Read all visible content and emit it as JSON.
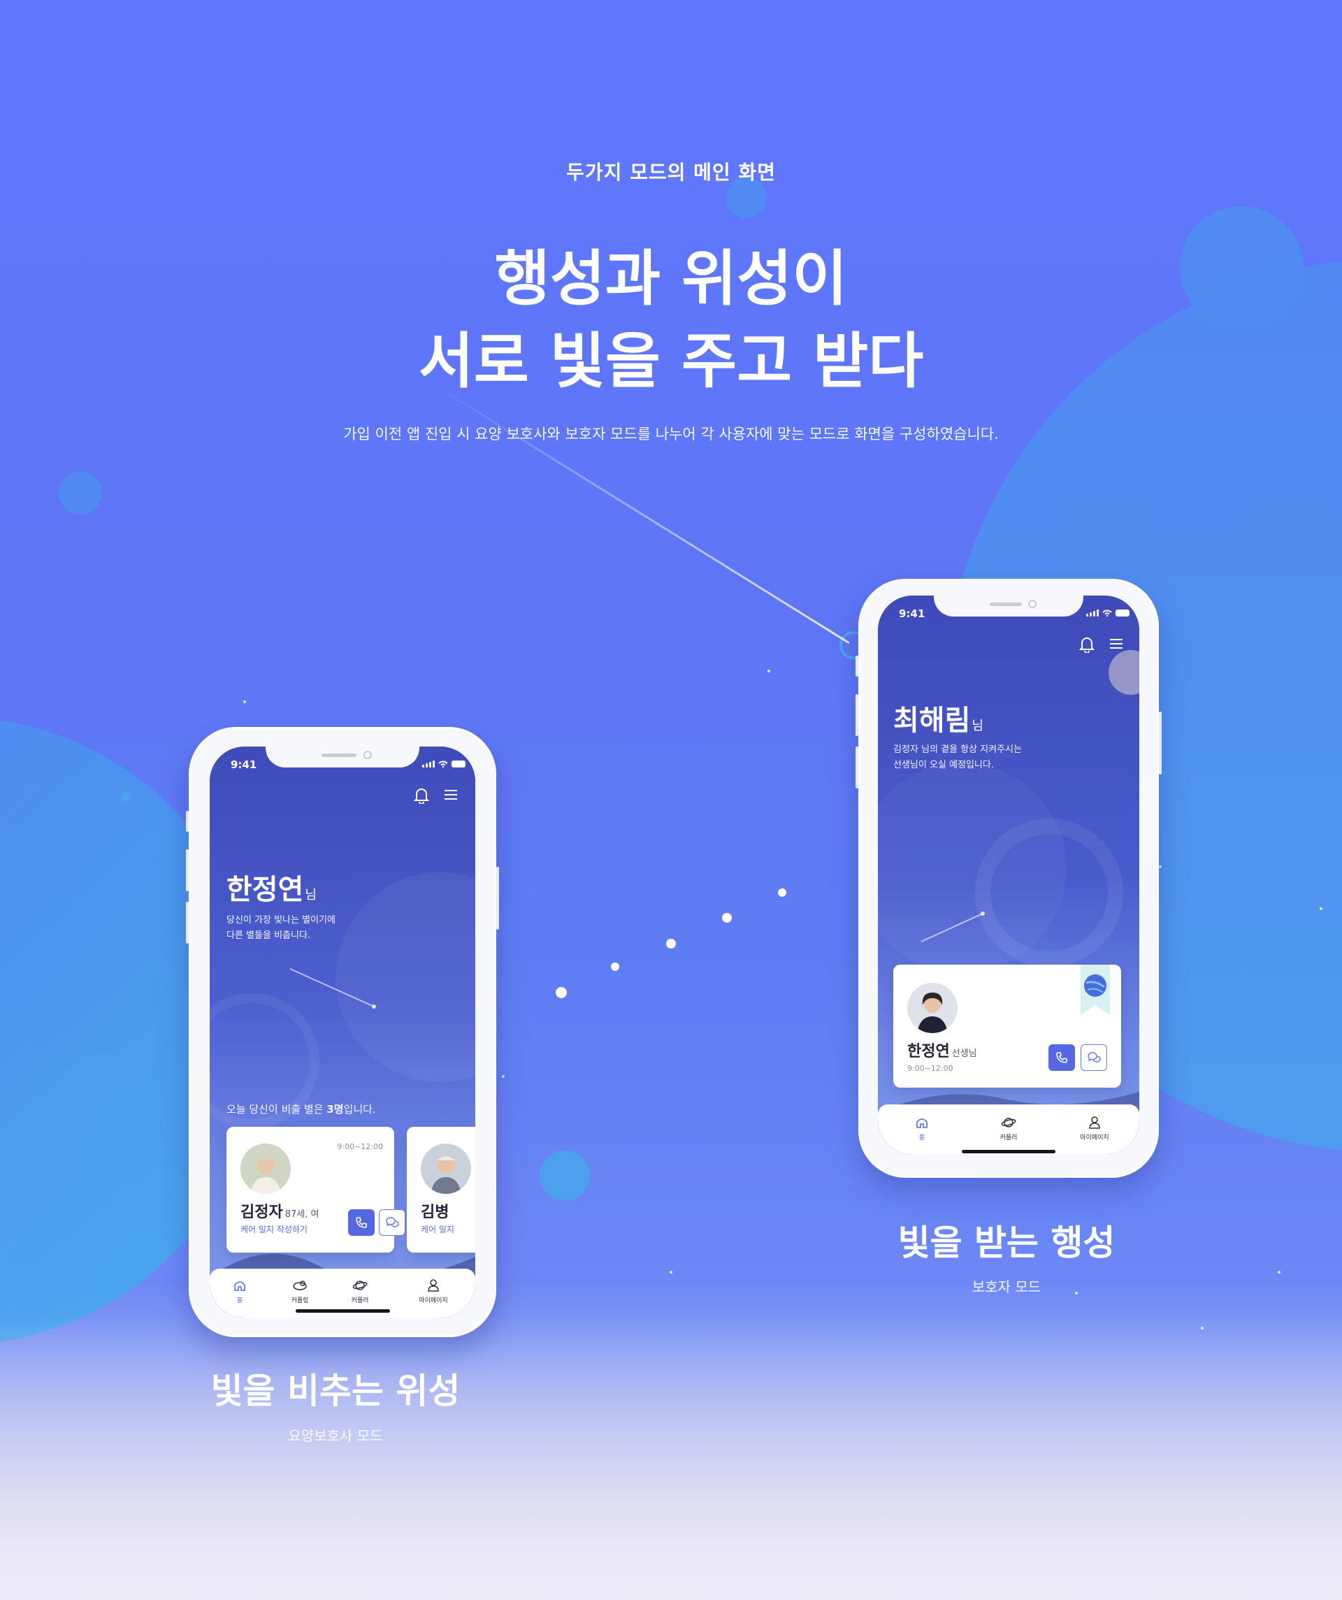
{
  "header": {
    "eyebrow": "두가지 모드의 메인 화면",
    "headline_line1": "행성과 위성이",
    "headline_line2": "서로 빛을 주고 받다",
    "description": "가입 이전 앱 진입 시 요양 보호사와 보호자 모드를 나누어 각 사용자에 맞는 모드로 화면을 구성하였습니다."
  },
  "caregiver_phone": {
    "status_time": "9:41",
    "user_name": "한정연",
    "honorific": "님",
    "greeting_line1": "당신이 가장 빛나는 별이기에",
    "greeting_line2": "다른 별들을 비춥니다.",
    "count_prefix": "오늘 당신이 비출 별은 ",
    "count_value": "3명",
    "count_suffix": "입니다.",
    "cards": [
      {
        "time": "9:00~12:00",
        "name": "김정자",
        "meta": "87세, 여",
        "link": "케어 일지 작성하기"
      },
      {
        "name": "김병",
        "link": "케어 일지"
      }
    ],
    "tabs": [
      {
        "label": "홈",
        "icon": "home-icon",
        "active": true
      },
      {
        "label": "커플링",
        "icon": "ring-icon",
        "active": false
      },
      {
        "label": "커플러",
        "icon": "planet-icon",
        "active": false
      },
      {
        "label": "마이페이지",
        "icon": "person-icon",
        "active": false
      }
    ]
  },
  "guardian_phone": {
    "status_time": "9:41",
    "user_name": "최해림",
    "honorific": "님",
    "greeting_line1": "김정자 님의 곁을 항상 지켜주시는",
    "greeting_line2": "선생님이 오실 예정입니다.",
    "card": {
      "name": "한정연",
      "title": "선생님",
      "time": "9:00~12:00"
    },
    "tabs": [
      {
        "label": "홈",
        "icon": "home-icon",
        "active": true
      },
      {
        "label": "커플러",
        "icon": "planet-icon",
        "active": false
      },
      {
        "label": "마이페이지",
        "icon": "person-icon",
        "active": false
      }
    ]
  },
  "captions": {
    "left_title": "빛을 비추는 위성",
    "left_sub": "요양보호사 모드",
    "right_title": "빛을 받는 행성",
    "right_sub": "보호자 모드"
  },
  "colors": {
    "background": "#5f78ff",
    "accent": "#5667e3",
    "bubble": "#4aa3ec",
    "text": "#ffffff"
  }
}
